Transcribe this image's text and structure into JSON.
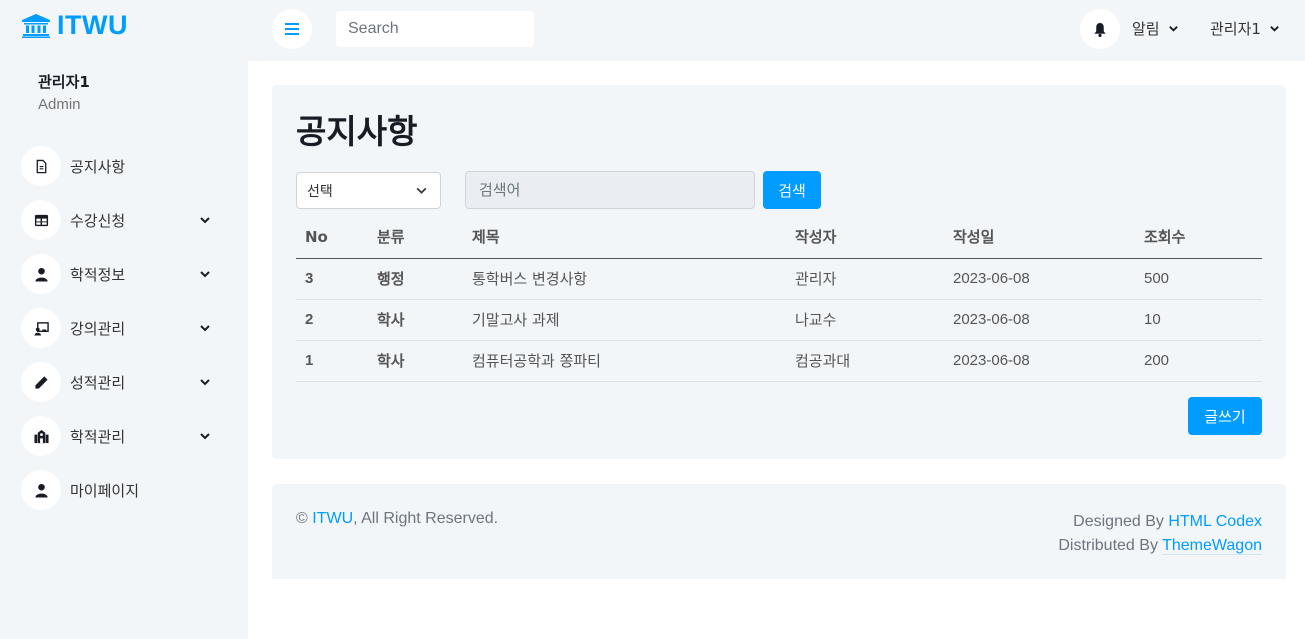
{
  "brand": {
    "name": "ITWU",
    "icon": "university-icon"
  },
  "profile": {
    "name": "관리자1",
    "role": "Admin"
  },
  "sidebar": {
    "items": [
      {
        "label": "공지사항",
        "icon": "file-icon",
        "dropdown": false
      },
      {
        "label": "수강신청",
        "icon": "table-icon",
        "dropdown": true
      },
      {
        "label": "학적정보",
        "icon": "user-icon",
        "dropdown": true
      },
      {
        "label": "강의관리",
        "icon": "chalkboard-teacher-icon",
        "dropdown": true
      },
      {
        "label": "성적관리",
        "icon": "pen-icon",
        "dropdown": true
      },
      {
        "label": "학적관리",
        "icon": "school-icon",
        "dropdown": true
      },
      {
        "label": "마이페이지",
        "icon": "user-icon",
        "dropdown": false
      }
    ]
  },
  "topbar": {
    "search_placeholder": "Search",
    "notifications_label": "알림",
    "user_label": "관리자1"
  },
  "main": {
    "title": "공지사항",
    "filter_select": "선택",
    "keyword_placeholder": "검색어",
    "search_button": "검색",
    "write_button": "글쓰기",
    "table": {
      "headers": [
        "No",
        "분류",
        "제목",
        "작성자",
        "작성일",
        "조회수"
      ],
      "rows": [
        [
          "3",
          "행정",
          "통학버스 변경사항",
          "관리자",
          "2023-06-08",
          "500"
        ],
        [
          "2",
          "학사",
          "기말고사 과제",
          "나교수",
          "2023-06-08",
          "10"
        ],
        [
          "1",
          "학사",
          "컴퓨터공학과 쫑파티",
          "컴공과대",
          "2023-06-08",
          "200"
        ]
      ]
    }
  },
  "footer": {
    "copyright_symbol": "©",
    "brand_link": "ITWU",
    "rights": ", All Right Reserved.",
    "designed_by": "Designed By",
    "designer_link": "HTML Codex",
    "distributed_by": "Distributed By",
    "distributor_link": "ThemeWagon"
  },
  "colors": {
    "accent": "#009cff",
    "panel": "#f3f6f9",
    "heading": "#191c24"
  }
}
